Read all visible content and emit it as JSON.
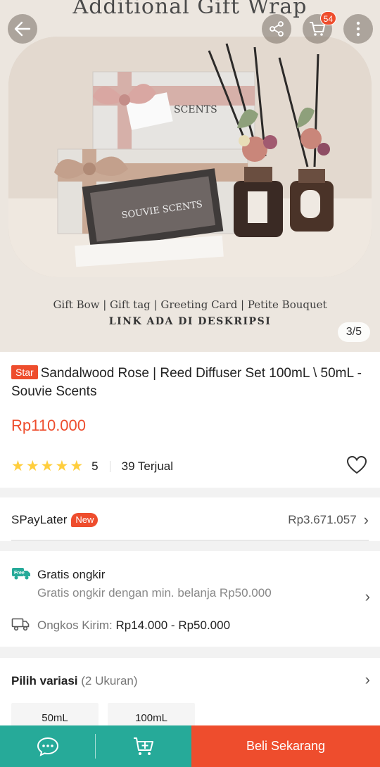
{
  "hero": {
    "title": "Additional Gift Wrap",
    "caption": "Gift Bow | Gift tag | Greeting Card | Petite Bouquet",
    "caption2": "LINK ADA DI DESKRIPSI",
    "box_label": "SCENTS",
    "card_label": "SOUVIE SCENTS",
    "counter": "3/5"
  },
  "header": {
    "cart_count": "54"
  },
  "product": {
    "badge": "Star",
    "title": "Sandalwood Rose | Reed Diffuser Set 100mL \\ 50mL - Souvie Scents",
    "price": "Rp110.000",
    "rating": "5",
    "sold": "39 Terjual"
  },
  "paylater": {
    "label": "SPayLater",
    "badge": "New",
    "amount": "Rp3.671.057"
  },
  "shipping": {
    "free_label": "Gratis ongkir",
    "free_desc": "Gratis ongkir dengan min. belanja Rp50.000",
    "cost_label": "Ongkos Kirim:",
    "cost_value": "Rp14.000 - Rp50.000",
    "free_icon_text": "Free"
  },
  "variants": {
    "title": "Pilih variasi",
    "count": "(2 Ukuran)",
    "options": [
      "50mL",
      "100mL"
    ]
  },
  "bottom": {
    "buy_label": "Beli Sekarang"
  },
  "colors": {
    "accent": "#ee4d2d",
    "teal": "#26aa99",
    "star": "#ffce3d"
  }
}
